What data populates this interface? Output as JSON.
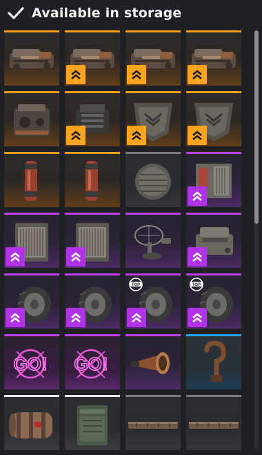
{
  "header": {
    "title": "Available in storage",
    "icon": "check-icon"
  },
  "colors": {
    "orange": "#ff9d1c",
    "purple": "#c040f0",
    "blue": "#27a3ef",
    "white": "#e8e8e8",
    "grey": "#7d7d7d"
  },
  "items": [
    {
      "name": "item-engine-long-1",
      "rarity": "orange",
      "art": "engine-long",
      "badge": null
    },
    {
      "name": "item-engine-long-2",
      "rarity": "orange",
      "art": "engine-long",
      "badge": "orange"
    },
    {
      "name": "item-engine-long-3",
      "rarity": "orange",
      "art": "engine-long",
      "badge": "orange"
    },
    {
      "name": "item-engine-long-4",
      "rarity": "orange",
      "art": "engine-long",
      "badge": "orange"
    },
    {
      "name": "item-engine-block-1",
      "rarity": "orange",
      "art": "engine-block",
      "badge": null
    },
    {
      "name": "item-engine-block-2",
      "rarity": "orange",
      "art": "engine-box",
      "badge": "orange"
    },
    {
      "name": "item-armor-plate-1",
      "rarity": "orange",
      "art": "armor-plate",
      "badge": "orange"
    },
    {
      "name": "item-armor-plate-2",
      "rarity": "orange",
      "art": "armor-plate",
      "badge": "orange"
    },
    {
      "name": "item-fuel-canister-1",
      "rarity": "orange",
      "art": "canister",
      "badge": null
    },
    {
      "name": "item-fuel-canister-2",
      "rarity": "orange",
      "art": "canister",
      "badge": null
    },
    {
      "name": "item-hatch-cover",
      "rarity": "grey",
      "art": "hatch",
      "badge": null
    },
    {
      "name": "item-radiator-generator",
      "rarity": "purple",
      "art": "radiator-gen",
      "badge": "purple"
    },
    {
      "name": "item-radiator-1",
      "rarity": "purple",
      "art": "radiator",
      "badge": "purple"
    },
    {
      "name": "item-radiator-2",
      "rarity": "purple",
      "art": "radiator",
      "badge": "purple"
    },
    {
      "name": "item-radar-turret",
      "rarity": "purple",
      "art": "radar",
      "badge": null
    },
    {
      "name": "item-engine-v8",
      "rarity": "purple",
      "art": "engine-v8",
      "badge": "purple"
    },
    {
      "name": "item-wheel-1",
      "rarity": "purple",
      "art": "wheel",
      "badge": "purple",
      "top": false
    },
    {
      "name": "item-wheel-2",
      "rarity": "purple",
      "art": "wheel",
      "badge": "purple",
      "top": false
    },
    {
      "name": "item-wheel-top-1",
      "rarity": "purple",
      "art": "wheel",
      "badge": "purple",
      "top": true
    },
    {
      "name": "item-wheel-top-2",
      "rarity": "purple",
      "art": "wheel",
      "badge": "purple",
      "top": true
    },
    {
      "name": "item-neon-sticker-1",
      "rarity": "purple-hot",
      "art": "neon",
      "badge": null
    },
    {
      "name": "item-neon-sticker-2",
      "rarity": "purple-hot",
      "art": "neon",
      "badge": null
    },
    {
      "name": "item-horn",
      "rarity": "purple",
      "art": "horn",
      "badge": null
    },
    {
      "name": "item-hook",
      "rarity": "blue",
      "art": "hook",
      "badge": null
    },
    {
      "name": "item-drum-cylinder",
      "rarity": "white",
      "art": "drum",
      "badge": null
    },
    {
      "name": "item-ammo-box",
      "rarity": "white",
      "art": "box",
      "badge": null
    },
    {
      "name": "item-beam-1",
      "rarity": "grey",
      "art": "beam",
      "badge": null
    },
    {
      "name": "item-beam-2",
      "rarity": "grey",
      "art": "beam",
      "badge": null
    }
  ],
  "neon_text": "GO!",
  "top_badge_text": "TOP"
}
